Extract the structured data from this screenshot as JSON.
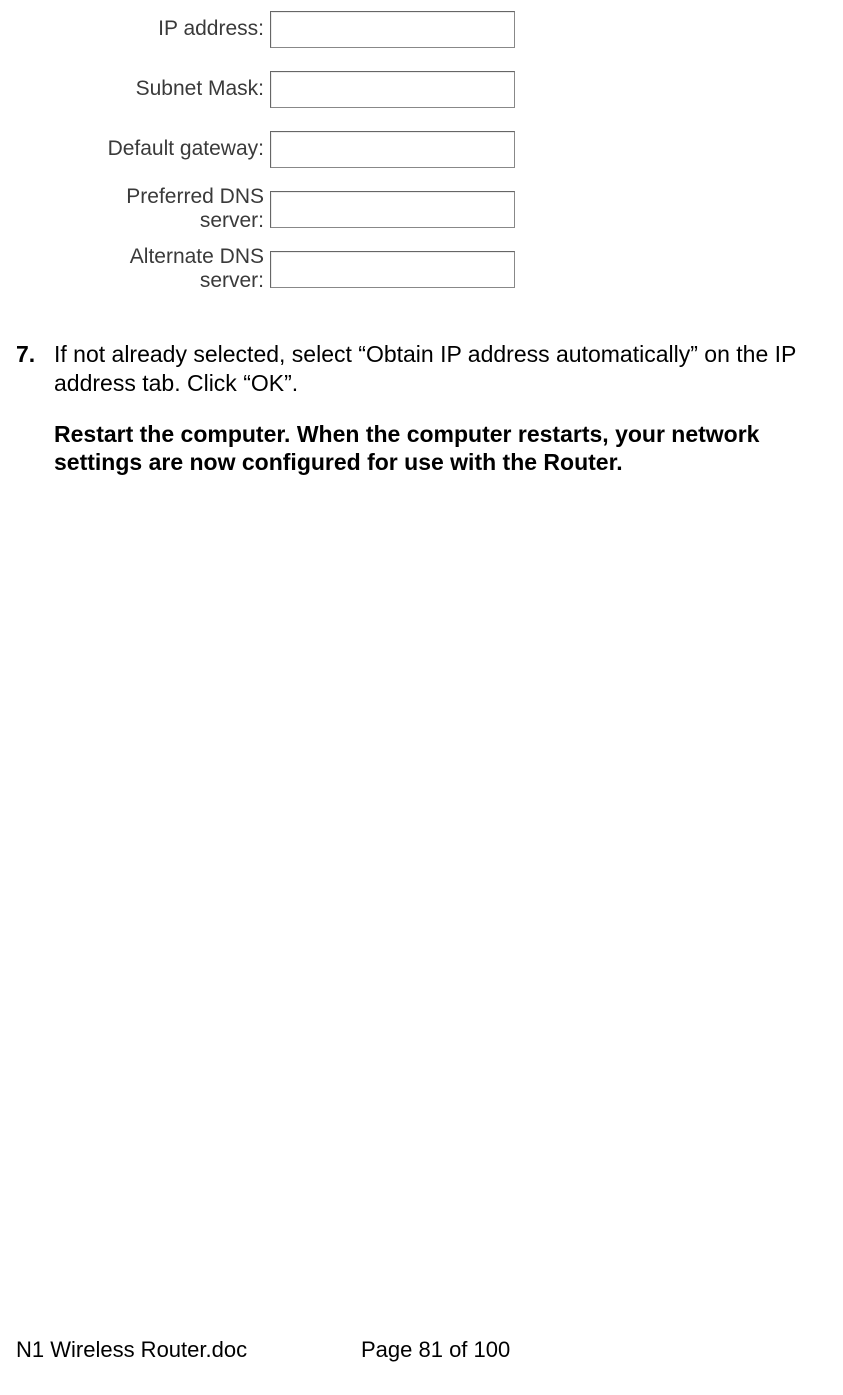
{
  "form": {
    "fields": [
      {
        "label": "IP address:",
        "value": ""
      },
      {
        "label": "Subnet Mask:",
        "value": ""
      },
      {
        "label": "Default gateway:",
        "value": ""
      },
      {
        "label": "Preferred DNS server:",
        "value": ""
      },
      {
        "label": "Alternate DNS server:",
        "value": ""
      }
    ]
  },
  "instruction": {
    "number": "7.",
    "text": "If not already selected, select “Obtain IP address automatically” on the IP address tab. Click “OK”.",
    "bold_text": "Restart the computer. When the computer restarts, your network settings are now configured for use with the Router."
  },
  "footer": {
    "doc_name": "N1 Wireless Router.doc",
    "page_info": "Page 81 of 100"
  }
}
